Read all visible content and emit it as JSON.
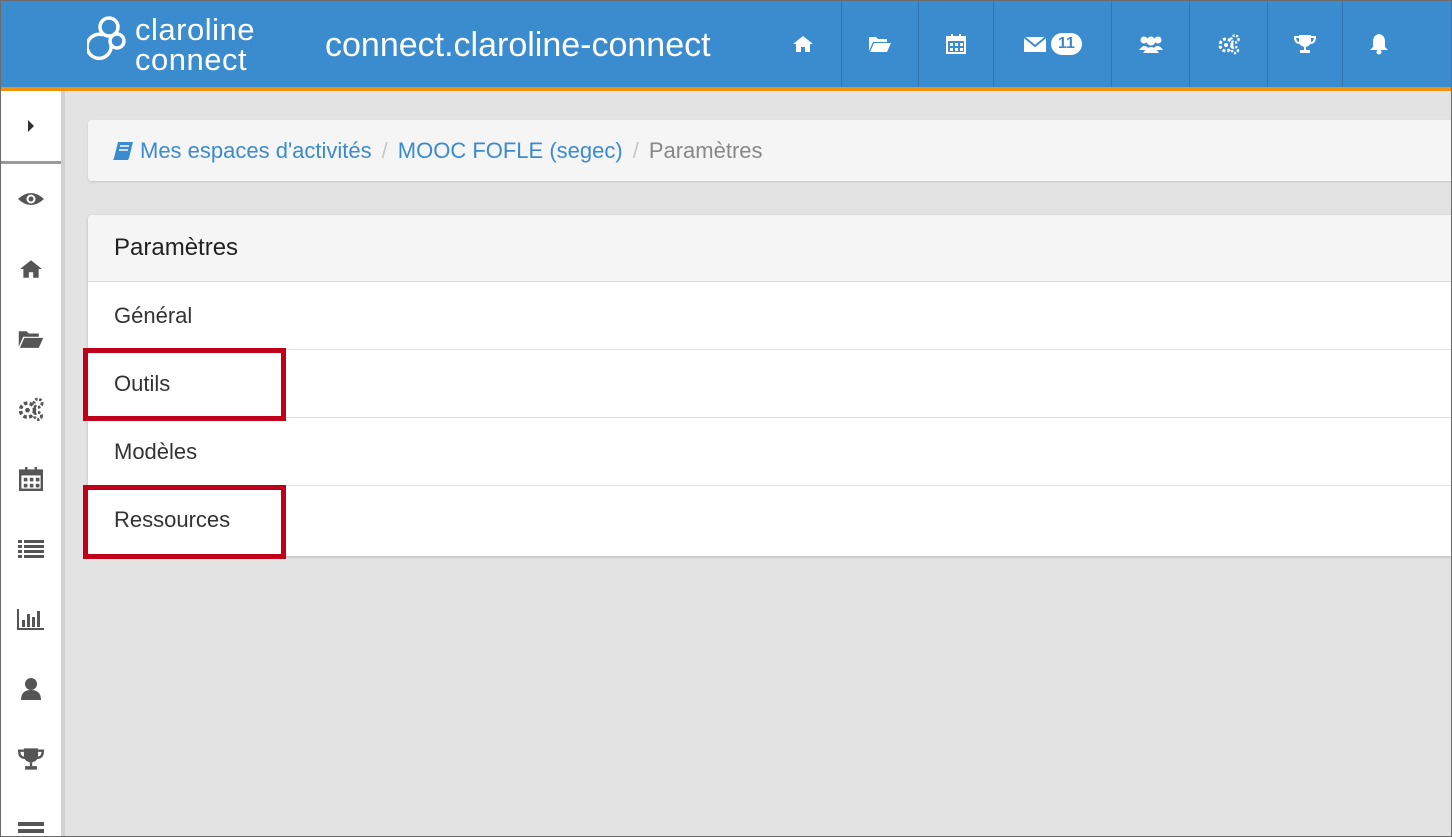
{
  "colors": {
    "navbar": "#3b8bcf",
    "navbar_accent": "#f2910d",
    "link": "#3b8bcf",
    "highlight": "#c0001a"
  },
  "header": {
    "logo_line1": "claroline",
    "logo_line2": "connect",
    "site_title": "connect.claroline-connect",
    "icons": [
      {
        "name": "home-icon"
      },
      {
        "name": "folder-open-icon"
      },
      {
        "name": "calendar-icon"
      },
      {
        "name": "envelope-icon",
        "badge": "11"
      },
      {
        "name": "users-icon"
      },
      {
        "name": "cogs-icon"
      },
      {
        "name": "trophy-icon"
      },
      {
        "name": "bell-icon"
      }
    ]
  },
  "sidebar": {
    "toggle_icon": "caret-right-icon",
    "icons": [
      "eye-icon",
      "home-icon",
      "folder-open-icon",
      "cogs-icon",
      "calendar-icon",
      "list-icon",
      "bar-chart-icon",
      "user-icon",
      "trophy-icon",
      "tasks-icon"
    ]
  },
  "breadcrumb": {
    "icon": "book-icon",
    "item1": "Mes espaces d'activités",
    "item2": "MOOC FOFLE (segec)",
    "current": "Paramètres",
    "separator": "/"
  },
  "panel": {
    "title": "Paramètres",
    "items": [
      {
        "label": "Général"
      },
      {
        "label": "Outils"
      },
      {
        "label": "Modèles"
      },
      {
        "label": "Ressources"
      }
    ]
  }
}
